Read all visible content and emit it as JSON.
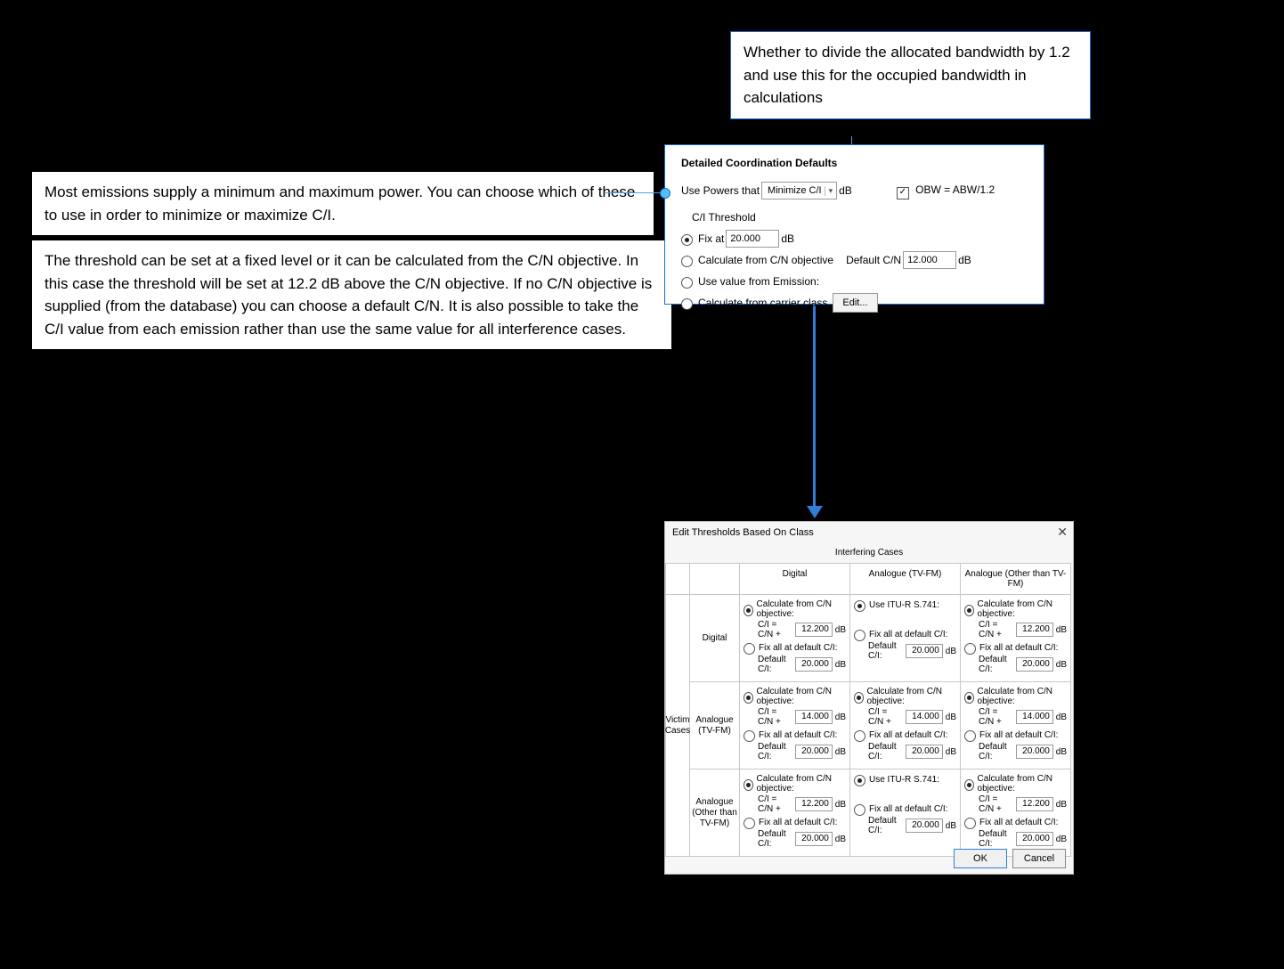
{
  "callouts": {
    "top": "Whether to divide the allocated bandwidth by 1.2 and use this for the occupied bandwidth in calculations",
    "mid": "Most emissions supply a minimum and maximum power. You can choose which of these to use in order to minimize or maximize C/I.",
    "lower": "The threshold can be set at a fixed level or it can be calculated from the C/N objective. In this case the threshold will be set at 12.2 dB above the C/N objective. If no C/N objective is supplied (from the database) you can choose a default C/N. It is also possible to take the C/I value from each emission rather than use the same value for all interference cases."
  },
  "panel1": {
    "title": "Detailed Coordination Defaults",
    "use_powers_label": "Use Powers that",
    "select_value": "Minimize C/I",
    "select_unit": "dB",
    "obw_label": "OBW = ABW/1.2",
    "ci_threshold_label": "C/I Threshold",
    "r_fix": "Fix at",
    "fix_value": "20.000",
    "fix_unit": "dB",
    "r_calc": "Calculate from C/N objective",
    "default_cn_label": "Default C/N",
    "default_cn_value": "12.000",
    "default_cn_unit": "dB",
    "r_emission": "Use value from Emission:",
    "r_carrier": "Calculate from carrier class",
    "edit_btn": "Edit..."
  },
  "panel2": {
    "title": "Edit Thresholds Based On Class",
    "interfering": "Interfering Cases",
    "victim": "Victim Cases",
    "col_digital": "Digital",
    "col_tvfm": "Analogue (TV-FM)",
    "col_other": "Analogue (Other than TV-FM)",
    "row_digital": "Digital",
    "row_tvfm": "Analogue (TV-FM)",
    "row_other": "Analogue (Other than TV-FM)",
    "opt_calc": "Calculate from C/N objective:",
    "opt_itu": "Use ITU-R S.741:",
    "ci_prefix": "C/I = C/N +",
    "opt_fix": "Fix all at default C/I:",
    "def_prefix": "Default C/I:",
    "db": "dB",
    "v12_2": "12.200",
    "v14": "14.000",
    "v20": "20.000",
    "ok": "OK",
    "cancel": "Cancel"
  }
}
